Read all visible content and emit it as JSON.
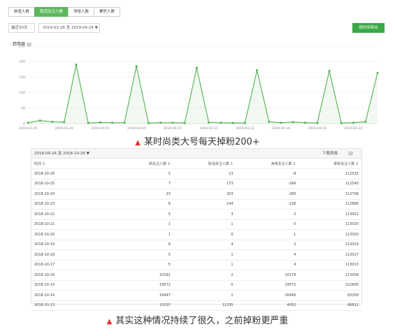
{
  "tabs": [
    {
      "label": "新增人数",
      "active": false
    },
    {
      "label": "取消关注人数",
      "active": true
    },
    {
      "label": "净增人数",
      "active": false
    },
    {
      "label": "累积人数",
      "active": false
    }
  ],
  "toolbar": {
    "range_label": "最近30天",
    "date_range": "2019-03-26 至 2019-04-24 ▼",
    "export_label": "按时间导出"
  },
  "chart": {
    "title": "趋势图",
    "help": "?"
  },
  "chart_data": {
    "type": "line",
    "title": "趋势图",
    "yticks": [
      "250",
      "200",
      "150",
      "100",
      "50",
      "0"
    ],
    "ylim": [
      0,
      250
    ],
    "xticks": [
      "2019-03-26",
      "2019-03-29",
      "2019-04-01",
      "2019-04-04",
      "2019-04-07",
      "2019-04-10",
      "2019-04-13",
      "2019-04-16",
      "2019-04-19",
      "2019-04-22"
    ],
    "values": [
      3,
      10,
      6,
      5,
      190,
      2,
      4,
      3,
      3,
      185,
      2,
      3,
      3,
      2,
      180,
      4,
      3,
      2,
      2,
      172,
      6,
      3,
      5,
      3,
      2,
      170,
      2,
      3,
      6,
      163
    ],
    "color": "#5cb85c",
    "grid": true
  },
  "caption1": {
    "marker": "▲",
    "text": "某时尚类大号每天掉粉200+"
  },
  "table": {
    "range_label": "2018-09-26 至 2018-10-26 ▼",
    "download_label": "下载表格",
    "help": "?",
    "headers": [
      "时间 ⇕",
      "新关注人数 ⇕",
      "取消关注人数 ⇕",
      "净增关注人数 ⇕",
      "累积关注人数 ⇕"
    ],
    "rows": [
      [
        "2018-10-26",
        "5",
        "13",
        "-8",
        "112532"
      ],
      [
        "2018-10-25",
        "7",
        "173",
        "-166",
        "112540"
      ],
      [
        "2018-10-24",
        "23",
        "203",
        "-180",
        "112706"
      ],
      [
        "2018-10-23",
        "8",
        "144",
        "-136",
        "112886"
      ],
      [
        "2018-10-22",
        "5",
        "3",
        "2",
        "113022"
      ],
      [
        "2018-10-21",
        "1",
        "1",
        "0",
        "113020"
      ],
      [
        "2018-10-20",
        "1",
        "0",
        "1",
        "113020"
      ],
      [
        "2018-10-19",
        "6",
        "4",
        "2",
        "113019"
      ],
      [
        "2018-10-18",
        "5",
        "1",
        "4",
        "113017"
      ],
      [
        "2018-10-17",
        "5",
        "1",
        "4",
        "113013"
      ],
      [
        "2018-10-16",
        "10181",
        "2",
        "10179",
        "113009"
      ],
      [
        "2018-10-15",
        "19572",
        "0",
        "19572",
        "102830"
      ],
      [
        "2018-10-14",
        "16447",
        "1",
        "16446",
        "83258"
      ],
      [
        "2018-10-13",
        "15207",
        "11235",
        "4052",
        "66812"
      ]
    ]
  },
  "caption2": {
    "marker": "▲",
    "text": "其实这种情况持续了很久，之前掉粉更严重"
  }
}
